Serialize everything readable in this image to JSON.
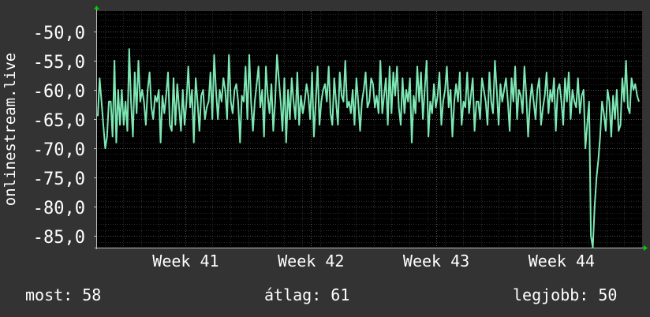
{
  "chart_data": {
    "type": "line",
    "ylabel": "onlinestream.live",
    "y_ticks": [
      -50,
      -55,
      -60,
      -65,
      -70,
      -75,
      -80,
      -85
    ],
    "y_tick_labels": [
      "-50,0",
      "-55,0",
      "-60,0",
      "-65,0",
      "-70,0",
      "-75,0",
      "-80,0",
      "-85,0"
    ],
    "ylim": [
      -87,
      -46.5
    ],
    "x_ticks": [
      "Week 41",
      "Week 42",
      "Week 43",
      "Week 44"
    ],
    "x_tick_positions": [
      8.5,
      15.5,
      22.5,
      29.5
    ],
    "xlim": [
      3.5,
      34.0
    ],
    "grid": true,
    "colors": {
      "line": "#7de8b4",
      "plot_bg": "#000000",
      "grid": "#555555",
      "axis": "#c0c0c0",
      "arrow": "#00cc00",
      "page_bg": "#333333"
    },
    "series": [
      {
        "values": [
          -64.5,
          -58,
          -62,
          -66,
          -70,
          -68,
          -62,
          -62,
          -68,
          -55,
          -69,
          -60,
          -66,
          -60,
          -66,
          -62,
          -67,
          -53,
          -62,
          -68,
          -57,
          -64,
          -55,
          -62,
          -60,
          -62,
          -66,
          -60,
          -57,
          -63,
          -65,
          -61,
          -62,
          -60,
          -69,
          -61,
          -64,
          -61,
          -57,
          -66,
          -67,
          -58,
          -66,
          -59,
          -63,
          -67,
          -60,
          -66,
          -62,
          -56,
          -63,
          -60,
          -69,
          -58,
          -62,
          -67,
          -61,
          -60,
          -65,
          -63,
          -62,
          -57,
          -65,
          -54,
          -60,
          -65,
          -60,
          -62,
          -58,
          -60,
          -65,
          -54,
          -62,
          -64,
          -60,
          -59,
          -62,
          -69,
          -61,
          -62,
          -56,
          -65,
          -54,
          -62,
          -67,
          -62,
          -59,
          -56,
          -63,
          -60,
          -68,
          -56,
          -61,
          -64,
          -59,
          -67,
          -62,
          -54,
          -58,
          -62,
          -67,
          -58,
          -69,
          -60,
          -65,
          -58,
          -62,
          -65,
          -57,
          -66,
          -61,
          -64,
          -62,
          -59,
          -61,
          -65,
          -57,
          -68,
          -62,
          -56,
          -66,
          -62,
          -60,
          -59,
          -62,
          -56,
          -64,
          -66,
          -58,
          -62,
          -66,
          -57,
          -61,
          -62,
          -55,
          -63,
          -62,
          -64,
          -60,
          -66,
          -58,
          -62,
          -67,
          -62,
          -60,
          -57,
          -63,
          -62,
          -58,
          -59,
          -63,
          -61,
          -64,
          -55,
          -64,
          -61,
          -58,
          -66,
          -56,
          -64,
          -57,
          -61,
          -56,
          -63,
          -66,
          -58,
          -64,
          -60,
          -62,
          -58,
          -69,
          -61,
          -64,
          -56,
          -62,
          -57,
          -65,
          -60,
          -55,
          -68,
          -62,
          -64,
          -59,
          -63,
          -61,
          -57,
          -66,
          -62,
          -60,
          -56,
          -63,
          -60,
          -68,
          -62,
          -59,
          -62,
          -57,
          -66,
          -62,
          -63,
          -57,
          -64,
          -61,
          -58,
          -67,
          -62,
          -62,
          -65,
          -58,
          -60,
          -62,
          -66,
          -57,
          -62,
          -64,
          -55,
          -60,
          -66,
          -59,
          -62,
          -60,
          -58,
          -62,
          -67,
          -58,
          -62,
          -56,
          -65,
          -60,
          -61,
          -64,
          -56,
          -61,
          -68,
          -62,
          -59,
          -62,
          -65,
          -60,
          -58,
          -66,
          -63,
          -61,
          -57,
          -64,
          -60,
          -62,
          -58,
          -67,
          -60,
          -59,
          -62,
          -66,
          -58,
          -62,
          -57,
          -65,
          -60,
          -62,
          -63,
          -58,
          -64,
          -61,
          -60,
          -70,
          -66,
          -62,
          -85,
          -87,
          -80,
          -75,
          -72,
          -68,
          -62,
          -64,
          -67,
          -60,
          -62,
          -68,
          -61,
          -65,
          -60,
          -67,
          -66,
          -58,
          -62,
          -55,
          -63,
          -64,
          -58,
          -60,
          -59,
          -61,
          -62
        ],
        "smooth": true
      }
    ]
  },
  "stats": {
    "current": "most: 58",
    "average": "átlag: 61",
    "best": "legjobb: 50"
  }
}
